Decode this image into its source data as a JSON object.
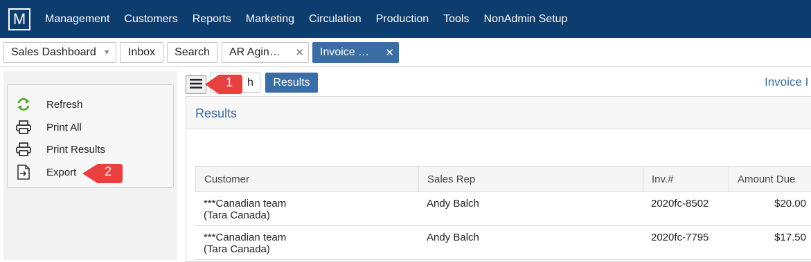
{
  "nav": {
    "logo": "M",
    "items": [
      "Management",
      "Customers",
      "Reports",
      "Marketing",
      "Circulation",
      "Production",
      "Tools",
      "NonAdmin Setup"
    ]
  },
  "tabs": {
    "sales_dashboard": "Sales Dashboard",
    "inbox": "Inbox",
    "search": "Search",
    "ar_aging": "AR Agin…",
    "invoice": "Invoice …",
    "close_glyph": "✕"
  },
  "left_menu": {
    "refresh": "Refresh",
    "print_all": "Print All",
    "print_results": "Print Results",
    "export": "Export"
  },
  "toolbar": {
    "search_label": "h",
    "results_label": "Results",
    "page_title": "Invoice I"
  },
  "panel": {
    "title": "Results"
  },
  "table": {
    "headers": [
      "Customer",
      "Sales Rep",
      "Inv.#",
      "Amount Due"
    ],
    "rows": [
      {
        "customer_line1": "***Canadian team",
        "customer_line2": "(Tara Canada)",
        "sales_rep": "Andy Balch",
        "inv": "2020fc-8502",
        "amount": "$20.00"
      },
      {
        "customer_line1": "***Canadian team",
        "customer_line2": "(Tara Canada)",
        "sales_rep": "Andy Balch",
        "inv": "2020fc-7795",
        "amount": "$17.50"
      }
    ]
  },
  "callouts": {
    "one": "1",
    "two": "2"
  },
  "colors": {
    "nav_bg": "#0d3c6e",
    "accent": "#3a6da3",
    "callout": "#e8403e"
  }
}
